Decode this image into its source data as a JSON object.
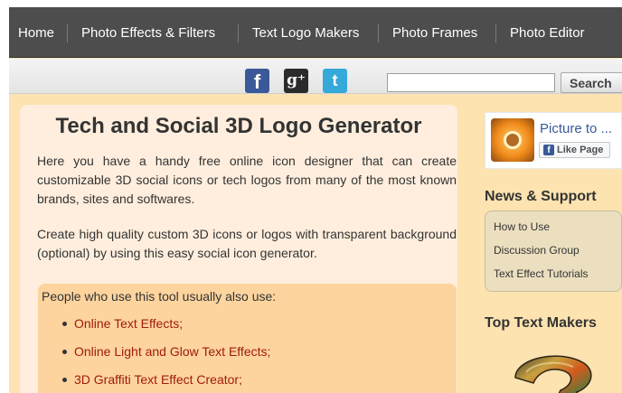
{
  "nav": {
    "items": [
      "Home",
      "Photo Effects & Filters",
      "Text Logo Makers",
      "Photo Frames",
      "Photo Editor"
    ]
  },
  "toolbar": {
    "social": [
      {
        "icon": "facebook-icon",
        "glyph": "f",
        "color": "#3b5998"
      },
      {
        "icon": "google-plus-icon",
        "glyph": "g⁺",
        "color": "#2b2b2b"
      },
      {
        "icon": "twitter-icon",
        "glyph": "t",
        "color": "#35a9d8"
      }
    ],
    "search": {
      "value": "",
      "placeholder": "",
      "button_label": "Search"
    }
  },
  "main": {
    "title": "Tech and Social 3D Logo Generator",
    "paragraph1": "Here you have a handy free online icon designer that can create customizable 3D social icons or tech logos from many of the most known brands, sites and softwares.",
    "paragraph2": "Create high quality custom 3D icons or logos with transparent background (optional) by using this easy social icon generator.",
    "also_use": {
      "heading": "People who use this tool usually also use:",
      "links": [
        "Online Text Effects;",
        "Online Light and Glow Text Effects;",
        "3D Graffiti Text Effect Creator;"
      ]
    }
  },
  "sidebar": {
    "facebook_widget": {
      "page_name": "Picture to ...",
      "like_label": "Like Page",
      "like_icon_glyph": "f"
    },
    "news_heading": "News & Support",
    "news_links": [
      "How to Use",
      "Discussion Group",
      "Text Effect Tutorials"
    ],
    "top_heading": "Top Text Makers"
  },
  "colors": {
    "nav_bg": "#4d4d4d",
    "page_bg": "#fde3b0",
    "panel_bg": "#ffeedd",
    "link_red": "#a11a0d",
    "facebook_blue": "#3b5998"
  }
}
